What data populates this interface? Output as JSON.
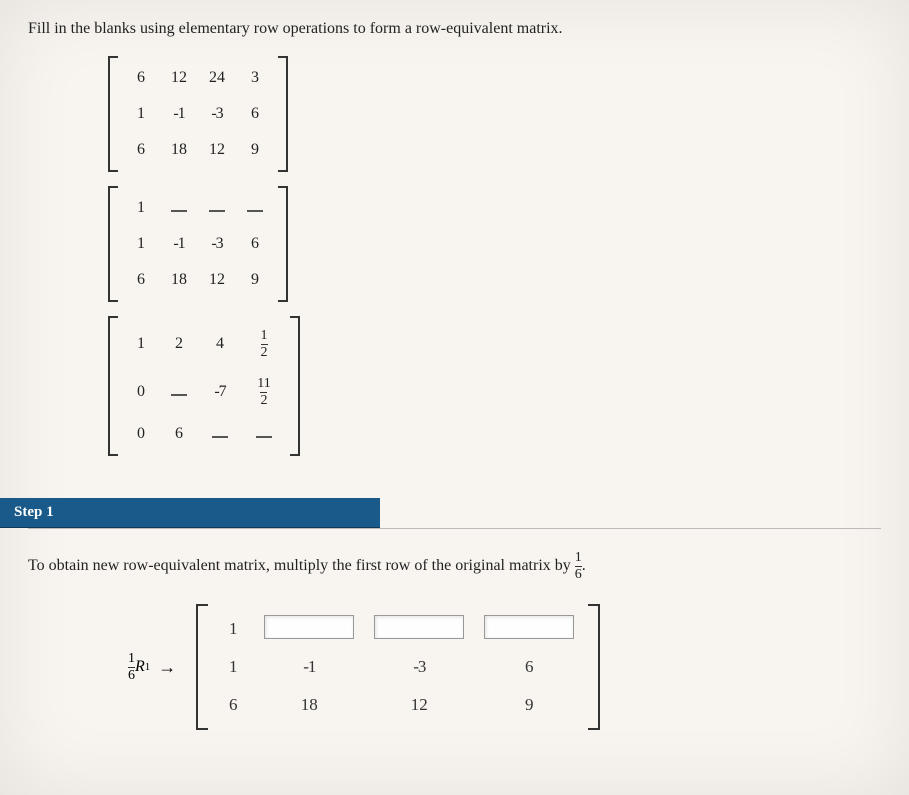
{
  "prompt": "Fill in the blanks using elementary row operations to form a row-equivalent matrix.",
  "matrices": {
    "m1": {
      "r1": [
        "6",
        "12",
        "24",
        "3"
      ],
      "r2": [
        "1",
        "-1",
        "-3",
        "6"
      ],
      "r3": [
        "6",
        "18",
        "12",
        "9"
      ]
    },
    "m2": {
      "r1": [
        "1",
        "_",
        "_",
        "_"
      ],
      "r2": [
        "1",
        "-1",
        "-3",
        "6"
      ],
      "r3": [
        "6",
        "18",
        "12",
        "9"
      ]
    },
    "m3": {
      "r1": [
        "1",
        "2",
        "4",
        "1/2"
      ],
      "r2": [
        "0",
        "_",
        "-7",
        "11/2"
      ],
      "r3": [
        "0",
        "6",
        "_",
        "_"
      ]
    }
  },
  "step1": {
    "label": "Step 1",
    "text_a": "To obtain new row-equivalent matrix, multiply the first row of the original matrix by ",
    "coef_num": "1",
    "coef_den": "6",
    "text_b": ".",
    "op_coef_num": "1",
    "op_coef_den": "6",
    "op_row": "R",
    "op_sub": "1",
    "result": {
      "r1_first": "1",
      "r2": [
        "1",
        "-1",
        "-3",
        "6"
      ],
      "r3": [
        "6",
        "18",
        "12",
        "9"
      ]
    }
  }
}
